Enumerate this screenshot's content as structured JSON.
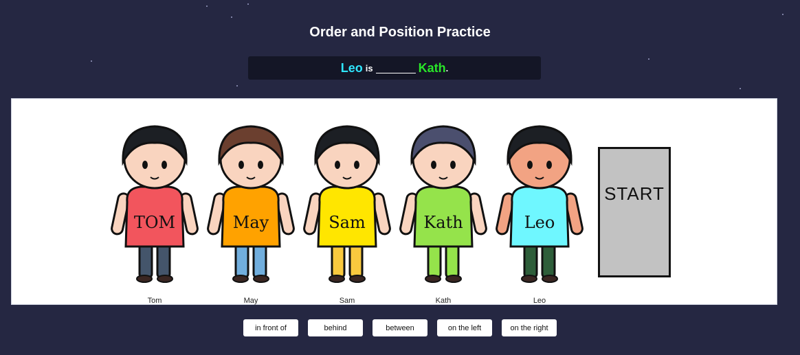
{
  "title": "Order and Position Practice",
  "question": {
    "subject": "Leo",
    "verb": "is",
    "object": "Kath",
    "end": "."
  },
  "characters": [
    {
      "name": "Tom",
      "shirt_text": "TOM",
      "shirt_color": "#f2555d",
      "pants_color": "#44556b",
      "skin": "#f9d4bf"
    },
    {
      "name": "May",
      "shirt_text": "May",
      "shirt_color": "#ffa200",
      "pants_color": "#71aedd",
      "skin": "#f9d4bf"
    },
    {
      "name": "Sam",
      "shirt_text": "Sam",
      "shirt_color": "#ffe600",
      "pants_color": "#f9c93e",
      "skin": "#f9d4bf"
    },
    {
      "name": "Kath",
      "shirt_text": "Kath",
      "shirt_color": "#95e34b",
      "pants_color": "#95e34b",
      "skin": "#f9d4bf"
    },
    {
      "name": "Leo",
      "shirt_text": "Leo",
      "shirt_color": "#6ff7ff",
      "pants_color": "#2e5e3a",
      "skin": "#f2a383"
    }
  ],
  "start_label": "START",
  "choices": [
    "in front of",
    "behind",
    "between",
    "on the left",
    "on the right"
  ],
  "colors": {
    "background": "#252742",
    "subject_color": "#2fe6ff",
    "object_color": "#29e629"
  }
}
